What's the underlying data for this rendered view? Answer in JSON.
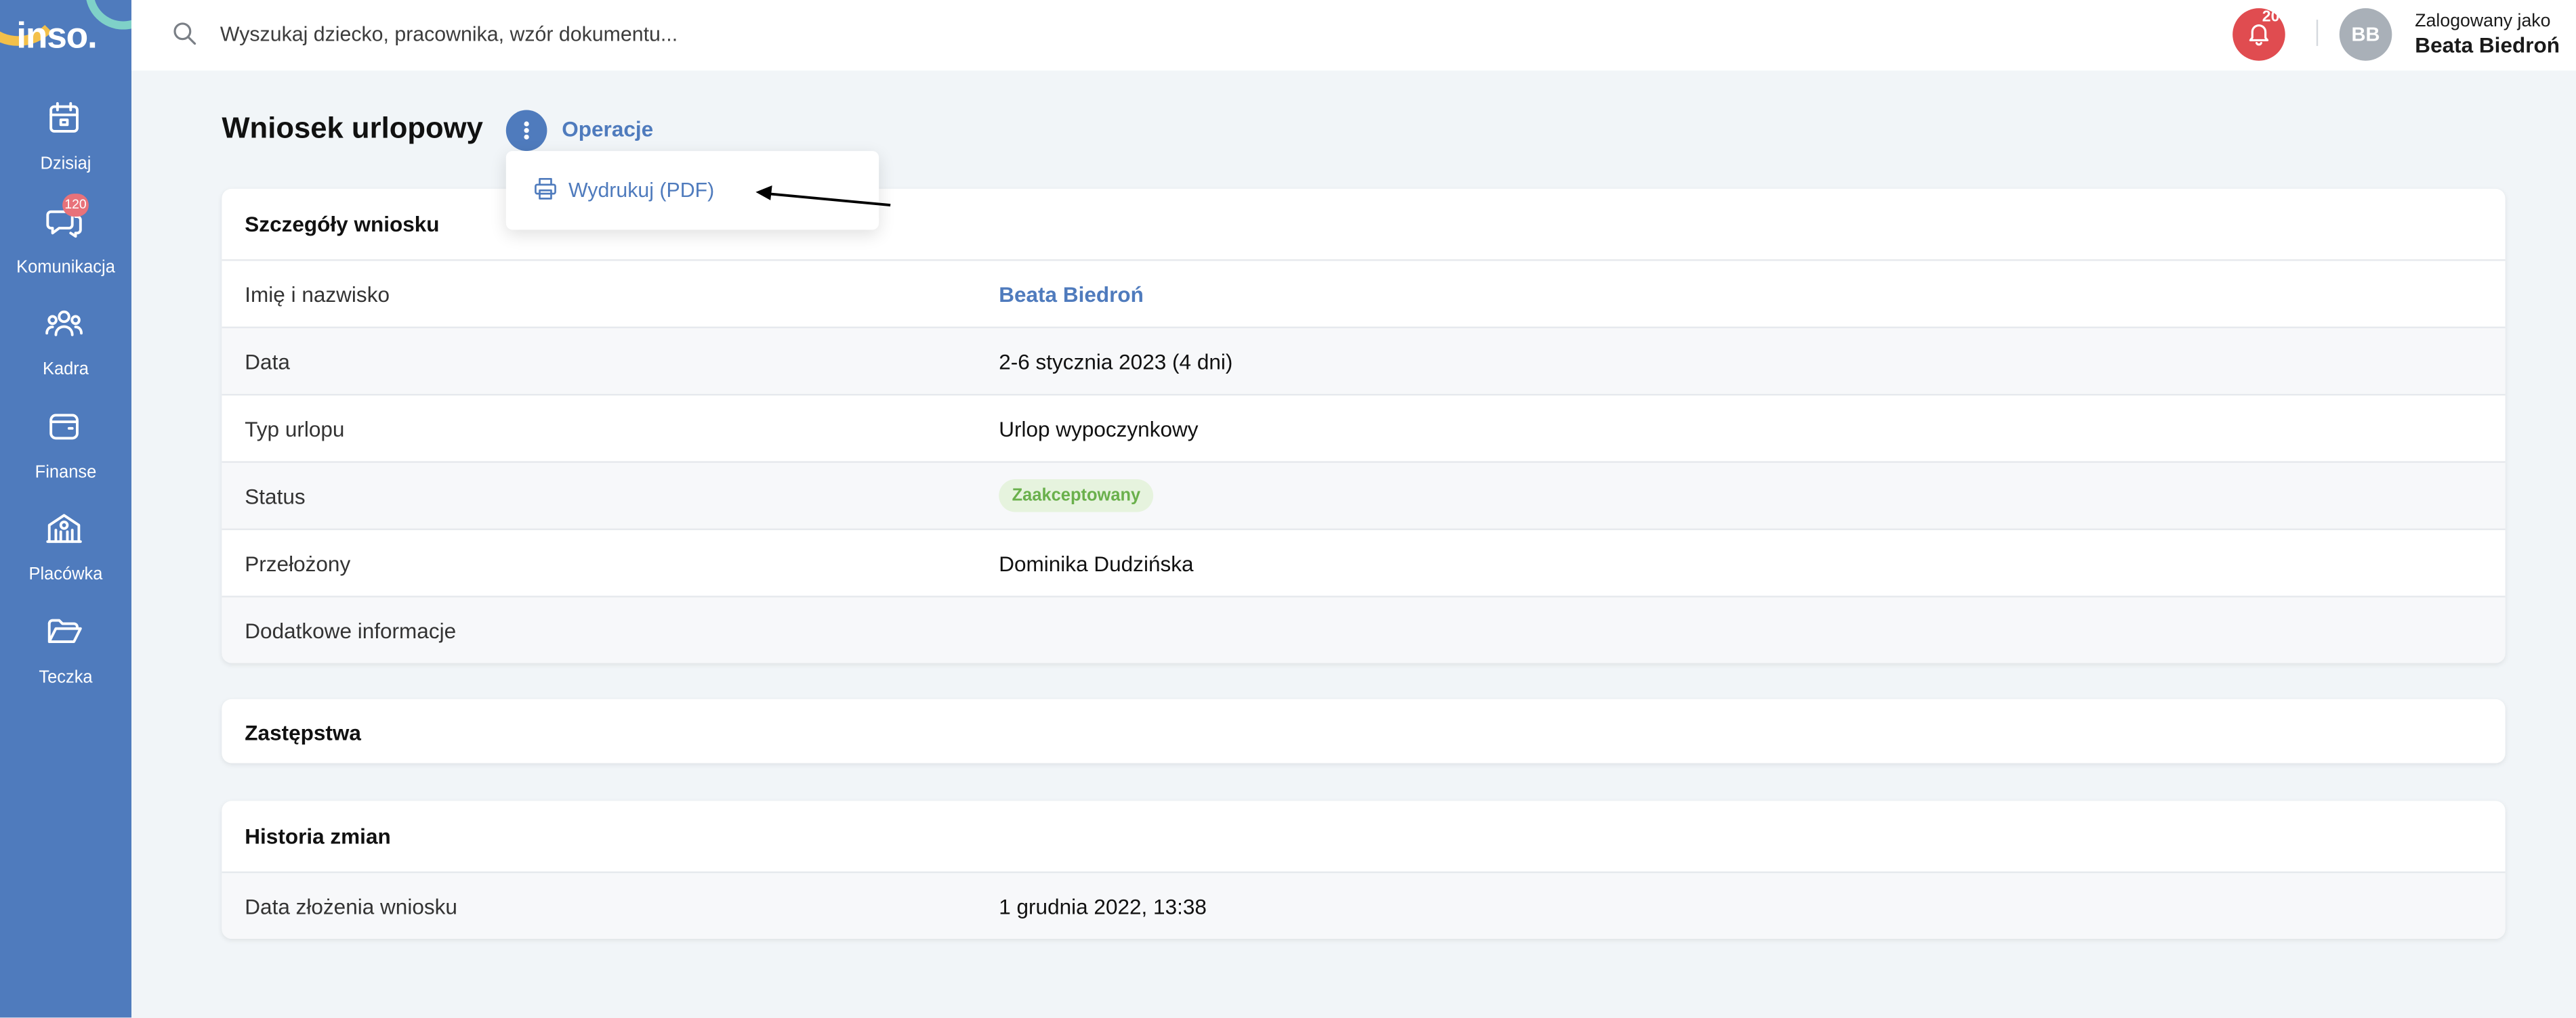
{
  "app": {
    "logo": "inso."
  },
  "colors": {
    "sidebar": "#4f7bbd",
    "accent": "#4f7bbd",
    "notification": "#e04c50",
    "status_ok_bg": "#e6f3de",
    "status_ok_text": "#6ab04c"
  },
  "sidebar": {
    "items": [
      {
        "label": "Dzisiaj",
        "icon": "calendar-icon"
      },
      {
        "label": "Komunikacja",
        "icon": "chat-icon",
        "badge": "120"
      },
      {
        "label": "Kadra",
        "icon": "people-icon"
      },
      {
        "label": "Finanse",
        "icon": "wallet-icon"
      },
      {
        "label": "Placówka",
        "icon": "building-icon"
      },
      {
        "label": "Teczka",
        "icon": "folder-icon"
      }
    ]
  },
  "topbar": {
    "search_placeholder": "Wyszukaj dziecko, pracownika, wzór dokumentu...",
    "notifications_count": "20",
    "avatar_initials": "BB",
    "logged_in_label": "Zalogowany jako",
    "user_name": "Beata Biedroń"
  },
  "page": {
    "title": "Wniosek urlopowy",
    "operations_label": "Operacje",
    "dropdown": {
      "print_label": "Wydrukuj (PDF)"
    }
  },
  "details": {
    "header": "Szczegóły wniosku",
    "rows": [
      {
        "label": "Imię i nazwisko",
        "value": "Beata Biedroń"
      },
      {
        "label": "Data",
        "value": "2-6 stycznia 2023 (4 dni)"
      },
      {
        "label": "Typ urlopu",
        "value": "Urlop wypoczynkowy"
      },
      {
        "label": "Status",
        "value": "Zaakceptowany"
      },
      {
        "label": "Przełożony",
        "value": "Dominika Dudzińska"
      },
      {
        "label": "Dodatkowe informacje",
        "value": ""
      }
    ]
  },
  "substitutions": {
    "header": "Zastępstwa"
  },
  "history": {
    "header": "Historia zmian",
    "rows": [
      {
        "label": "Data złożenia wniosku",
        "value": "1 grudnia 2022, 13:38"
      }
    ]
  }
}
